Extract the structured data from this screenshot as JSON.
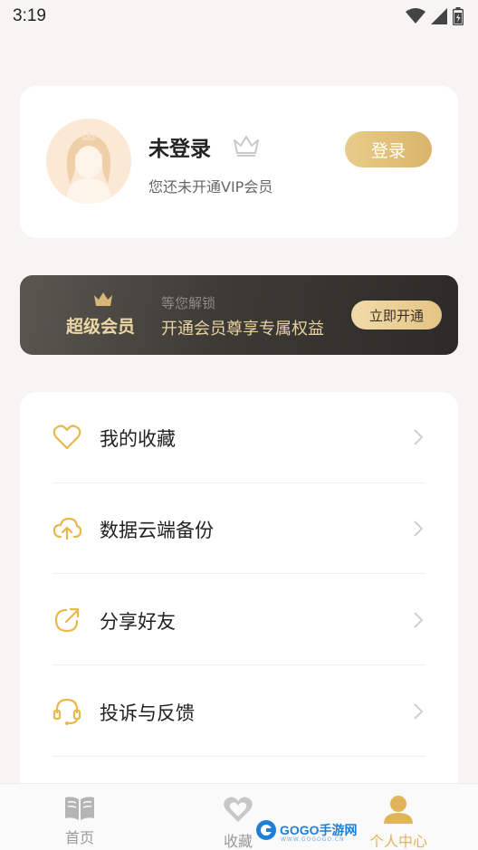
{
  "status_bar": {
    "time": "3:19"
  },
  "profile": {
    "username": "未登录",
    "vip_status": "您还未开通VIP会员",
    "login_label": "登录"
  },
  "vip_banner": {
    "title": "超级会员",
    "hint": "等您解锁",
    "description": "开通会员尊享专属权益",
    "button_label": "立即开通",
    "accent_color": "#ecd7a6"
  },
  "menu": {
    "items": [
      {
        "label": "我的收藏",
        "icon": "heart-icon"
      },
      {
        "label": "数据云端备份",
        "icon": "cloud-upload-icon"
      },
      {
        "label": "分享好友",
        "icon": "share-icon"
      },
      {
        "label": "投诉与反馈",
        "icon": "headset-icon"
      }
    ],
    "icon_color": "#e8b84a"
  },
  "bottom_nav": {
    "items": [
      {
        "label": "首页",
        "icon": "book-icon",
        "active": false
      },
      {
        "label": "收藏",
        "icon": "heart-icon",
        "active": false
      },
      {
        "label": "个人中心",
        "icon": "person-icon",
        "active": true
      }
    ],
    "active_color": "#e0b45a",
    "inactive_color": "#9a9a9a"
  },
  "watermark": {
    "text": "GOGO手游网",
    "sub": "WWW.GOGOGO.CN"
  }
}
